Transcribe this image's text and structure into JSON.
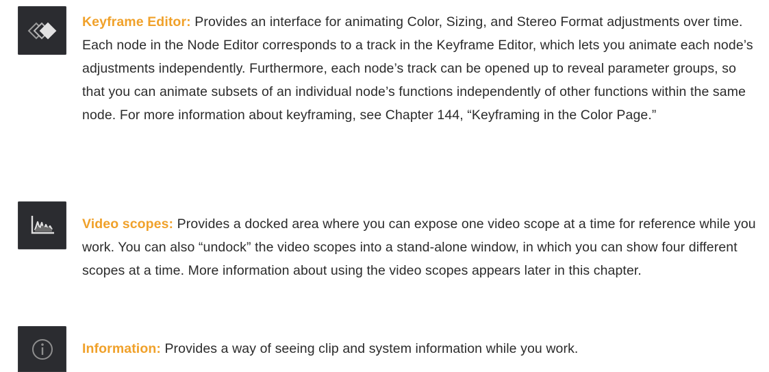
{
  "entries": [
    {
      "icon": "keyframe-diamonds-icon",
      "term": "Keyframe Editor:",
      "description": " Provides an interface for animating Color, Sizing, and Stereo Format adjustments over time. Each node in the Node Editor corresponds to a track in the Keyframe Editor, which lets you animate each node’s adjustments independently. Furthermore, each node’s track can be opened up to reveal parameter groups, so that you can animate subsets of an individual node’s functions independently of other functions within the same node. For more information about keyframing, see Chapter 144, “Keyframing in the Color Page.”"
    },
    {
      "icon": "waveform-scope-icon",
      "term": "Video scopes:",
      "description": " Provides a docked area where you can expose one video scope at a time for reference while you work. You can also “undock” the video scopes into a stand-alone window, in which you can show four different scopes at a time. More information about using the video scopes appears later in this chapter."
    },
    {
      "icon": "info-circle-icon",
      "term": "Information:",
      "description": " Provides a way of seeing clip and system information while you work."
    }
  ],
  "colors": {
    "term": "#f0a12a",
    "body_text": "#2b2b2b",
    "icon_tile": "#2b2c30",
    "icon_glyph": "#d8d8d8"
  }
}
